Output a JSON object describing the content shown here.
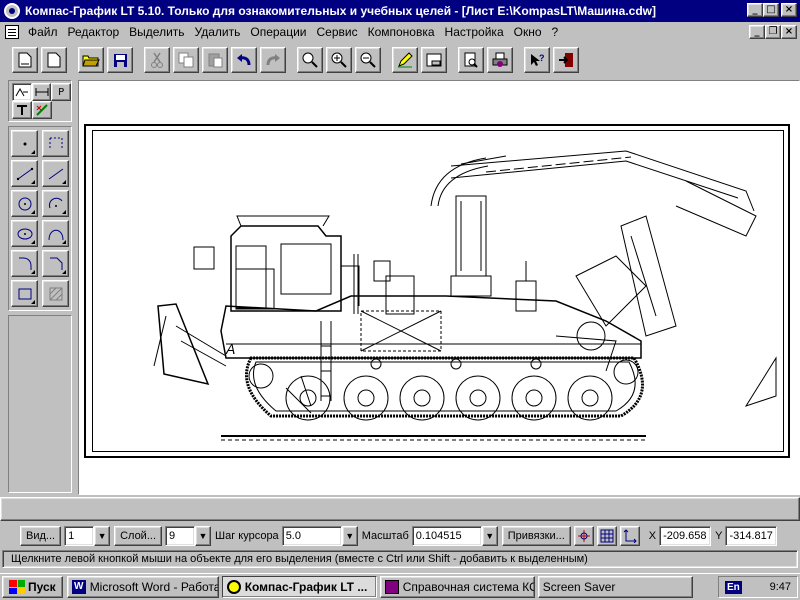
{
  "window": {
    "title": "Компас-График LT 5.10. Только для ознакомительных и учебных целей - [Лист E:\\KompasLT\\Машина.cdw]"
  },
  "menu": {
    "items": [
      "Файл",
      "Редактор",
      "Выделить",
      "Удалить",
      "Операции",
      "Сервис",
      "Компоновка",
      "Настройка",
      "Окно",
      "?"
    ]
  },
  "toolbar": {
    "icons": [
      "new-sheet",
      "new-fragment",
      "open",
      "save",
      "cut",
      "copy",
      "paste",
      "undo",
      "redo",
      "zoom",
      "zoom-in",
      "zoom-out",
      "edit",
      "layout",
      "preview",
      "print",
      "help",
      "exit"
    ]
  },
  "lefttool": {
    "tabs": [
      "P"
    ]
  },
  "statusbar": {
    "view_btn": "Вид...",
    "view_val": "1",
    "layer_btn": "Слой...",
    "layer_val": "9",
    "step_label": "Шаг курсора",
    "step_val": "5.0",
    "scale_label": "Масштаб",
    "scale_val": "0.104515",
    "snap_btn": "Привязки...",
    "x_label": "X",
    "x_val": "-209.658",
    "y_label": "Y",
    "y_val": "-314.817"
  },
  "hint": "Щелкните левой кнопкой мыши на объекте для его выделения (вместе с Ctrl или Shift - добавить к выделенным)",
  "taskbar": {
    "start": "Пуск",
    "tasks": [
      "Microsoft Word - Работа ...",
      "Компас-График LT ...",
      "Справочная система КО...",
      "Screen Saver"
    ],
    "lang": "En",
    "time": "9:47"
  },
  "drawing": {
    "label_a": "A"
  }
}
